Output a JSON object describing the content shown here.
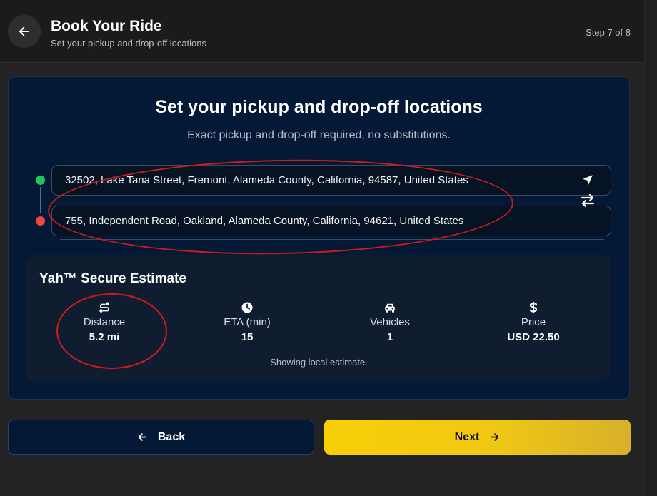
{
  "header": {
    "title": "Book Your Ride",
    "subtitle": "Set your pickup and drop-off locations",
    "step": "Step 7 of 8",
    "back_icon": "arrow-left-icon"
  },
  "main": {
    "title": "Set your pickup and drop-off locations",
    "subtitle": "Exact pickup and drop-off required, no substitutions.",
    "pickup": {
      "value": "32502, Lake Tana Street, Fremont, Alameda County, California, 94587, United States",
      "marker_color": "#22c55e"
    },
    "dropoff": {
      "value": "755, Independent Road, Oakland, Alameda County, California, 94621, United States",
      "marker_color": "#ef4444"
    },
    "actions": {
      "locate_icon": "navigation-arrow-icon",
      "swap_icon": "swap-arrows-icon"
    }
  },
  "estimate": {
    "title": "Yah™ Secure Estimate",
    "metrics": [
      {
        "icon": "route-icon",
        "label": "Distance",
        "value": "5.2 mi"
      },
      {
        "icon": "clock-icon",
        "label": "ETA (min)",
        "value": "15"
      },
      {
        "icon": "car-icon",
        "label": "Vehicles",
        "value": "1"
      },
      {
        "icon": "dollar-icon",
        "label": "Price",
        "value": "USD 22.50"
      }
    ],
    "note": "Showing local estimate."
  },
  "footer": {
    "back_label": "Back",
    "next_label": "Next"
  },
  "colors": {
    "accent": "#f7cf06",
    "card_background": "#031935",
    "annotation": "#d11a1a"
  }
}
